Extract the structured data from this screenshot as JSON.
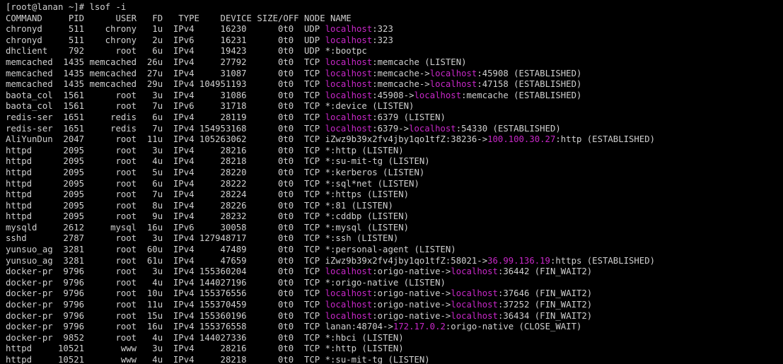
{
  "terminal": {
    "prompt": "[root@lanan ~]# lsof -i",
    "header": "COMMAND     PID      USER   FD   TYPE    DEVICE SIZE/OFF NODE NAME"
  },
  "rows": [
    [
      {
        "t": "chronyd     511    chrony   1u  IPv4     16230      0t0  UDP "
      },
      {
        "t": "localhost",
        "c": 1
      },
      {
        "t": ":323"
      }
    ],
    [
      {
        "t": "chronyd     511    chrony   2u  IPv6     16231      0t0  UDP "
      },
      {
        "t": "localhost",
        "c": 1
      },
      {
        "t": ":323"
      }
    ],
    [
      {
        "t": "dhclient    792      root   6u  IPv4     19423      0t0  UDP *:bootpc"
      }
    ],
    [
      {
        "t": "memcached  1435 memcached  26u  IPv4     27792      0t0  TCP "
      },
      {
        "t": "localhost",
        "c": 1
      },
      {
        "t": ":memcache (LISTEN)"
      }
    ],
    [
      {
        "t": "memcached  1435 memcached  27u  IPv4     31087      0t0  TCP "
      },
      {
        "t": "localhost",
        "c": 1
      },
      {
        "t": ":memcache->"
      },
      {
        "t": "localhost",
        "c": 1
      },
      {
        "t": ":45908 (ESTABLISHED)"
      }
    ],
    [
      {
        "t": "memcached  1435 memcached  29u  IPv4 104951193      0t0  TCP "
      },
      {
        "t": "localhost",
        "c": 1
      },
      {
        "t": ":memcache->"
      },
      {
        "t": "localhost",
        "c": 1
      },
      {
        "t": ":47158 (ESTABLISHED)"
      }
    ],
    [
      {
        "t": "baota_col  1561      root   3u  IPv4     31086      0t0  TCP "
      },
      {
        "t": "localhost",
        "c": 1
      },
      {
        "t": ":45908->"
      },
      {
        "t": "localhost",
        "c": 1
      },
      {
        "t": ":memcache (ESTABLISHED)"
      }
    ],
    [
      {
        "t": "baota_col  1561      root   7u  IPv6     31718      0t0  TCP *:device (LISTEN)"
      }
    ],
    [
      {
        "t": "redis-ser  1651     redis   6u  IPv4     28119      0t0  TCP "
      },
      {
        "t": "localhost",
        "c": 1
      },
      {
        "t": ":6379 (LISTEN)"
      }
    ],
    [
      {
        "t": "redis-ser  1651     redis   7u  IPv4 154953168      0t0  TCP "
      },
      {
        "t": "localhost",
        "c": 1
      },
      {
        "t": ":6379->"
      },
      {
        "t": "localhost",
        "c": 1
      },
      {
        "t": ":54330 (ESTABLISHED)"
      }
    ],
    [
      {
        "t": "AliYunDun  2047      root  11u  IPv4 105263062      0t0  TCP iZwz9b39x2fv4jby1qo1tfZ:38236->"
      },
      {
        "t": "100.100.30.27",
        "c": 1
      },
      {
        "t": ":http (ESTABLISHED)"
      }
    ],
    [
      {
        "t": "httpd      2095      root   3u  IPv4     28216      0t0  TCP *:http (LISTEN)"
      }
    ],
    [
      {
        "t": "httpd      2095      root   4u  IPv4     28218      0t0  TCP *:su-mit-tg (LISTEN)"
      }
    ],
    [
      {
        "t": "httpd      2095      root   5u  IPv4     28220      0t0  TCP *:kerberos (LISTEN)"
      }
    ],
    [
      {
        "t": "httpd      2095      root   6u  IPv4     28222      0t0  TCP *:sql*net (LISTEN)"
      }
    ],
    [
      {
        "t": "httpd      2095      root   7u  IPv4     28224      0t0  TCP *:https (LISTEN)"
      }
    ],
    [
      {
        "t": "httpd      2095      root   8u  IPv4     28226      0t0  TCP *:81 (LISTEN)"
      }
    ],
    [
      {
        "t": "httpd      2095      root   9u  IPv4     28232      0t0  TCP *:cddbp (LISTEN)"
      }
    ],
    [
      {
        "t": "mysqld     2612     mysql  16u  IPv6     30058      0t0  TCP *:mysql (LISTEN)"
      }
    ],
    [
      {
        "t": "sshd       2787      root   3u  IPv4 127948717      0t0  TCP *:ssh (LISTEN)"
      }
    ],
    [
      {
        "t": "yunsuo_ag  3281      root  60u  IPv4     47489      0t0  TCP *:personal-agent (LISTEN)"
      }
    ],
    [
      {
        "t": "yunsuo_ag  3281      root  61u  IPv4     47659      0t0  TCP iZwz9b39x2fv4jby1qo1tfZ:58021->"
      },
      {
        "t": "36.99.136.19",
        "c": 1
      },
      {
        "t": ":https (ESTABLISHED)"
      }
    ],
    [
      {
        "t": "docker-pr  9796      root   3u  IPv4 155360204      0t0  TCP "
      },
      {
        "t": "localhost",
        "c": 1
      },
      {
        "t": ":origo-native->"
      },
      {
        "t": "localhost",
        "c": 1
      },
      {
        "t": ":36442 (FIN_WAIT2)"
      }
    ],
    [
      {
        "t": "docker-pr  9796      root   4u  IPv4 144027196      0t0  TCP *:origo-native (LISTEN)"
      }
    ],
    [
      {
        "t": "docker-pr  9796      root  10u  IPv4 155376556      0t0  TCP "
      },
      {
        "t": "localhost",
        "c": 1
      },
      {
        "t": ":origo-native->"
      },
      {
        "t": "localhost",
        "c": 1
      },
      {
        "t": ":37646 (FIN_WAIT2)"
      }
    ],
    [
      {
        "t": "docker-pr  9796      root  11u  IPv4 155370459      0t0  TCP "
      },
      {
        "t": "localhost",
        "c": 1
      },
      {
        "t": ":origo-native->"
      },
      {
        "t": "localhost",
        "c": 1
      },
      {
        "t": ":37252 (FIN_WAIT2)"
      }
    ],
    [
      {
        "t": "docker-pr  9796      root  15u  IPv4 155360196      0t0  TCP "
      },
      {
        "t": "localhost",
        "c": 1
      },
      {
        "t": ":origo-native->"
      },
      {
        "t": "localhost",
        "c": 1
      },
      {
        "t": ":36434 (FIN_WAIT2)"
      }
    ],
    [
      {
        "t": "docker-pr  9796      root  16u  IPv4 155376558      0t0  TCP lanan:48704->"
      },
      {
        "t": "172.17.0.2",
        "c": 1
      },
      {
        "t": ":origo-native (CLOSE_WAIT)"
      }
    ],
    [
      {
        "t": "docker-pr  9852      root   4u  IPv4 144027336      0t0  TCP *:hbci (LISTEN)"
      }
    ],
    [
      {
        "t": "httpd     10521       www   3u  IPv4     28216      0t0  TCP *:http (LISTEN)"
      }
    ],
    [
      {
        "t": "httpd     10521       www   4u  IPv4     28218      0t0  TCP *:su-mit-tg (LISTEN)"
      }
    ]
  ],
  "colors": {
    "background": "#000000",
    "text": "#d0d0d0",
    "highlight": "#c828c8"
  }
}
